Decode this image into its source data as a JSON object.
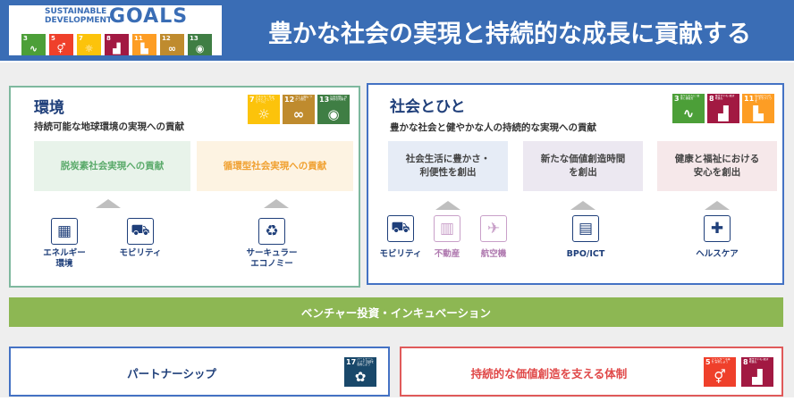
{
  "header": {
    "logo_line1": "SUSTAINABLE",
    "logo_line2": "DEVELOPMENT",
    "logo_goals": "GOALS",
    "title": "豊かな社会の実現と持続的な成長に貢献する",
    "sdg_icons": [
      {
        "num": "3",
        "color": "#4c9f38",
        "icon": "heartbeat-icon",
        "glyph": "∿"
      },
      {
        "num": "5",
        "color": "#ef402b",
        "icon": "gender-icon",
        "glyph": "⚥"
      },
      {
        "num": "7",
        "color": "#fcc30b",
        "icon": "sun-icon",
        "glyph": "☼"
      },
      {
        "num": "8",
        "color": "#a21942",
        "icon": "growth-chart-icon",
        "glyph": "▟"
      },
      {
        "num": "11",
        "color": "#fd9d24",
        "icon": "city-icon",
        "glyph": "▙"
      },
      {
        "num": "12",
        "color": "#bf8b2e",
        "icon": "infinity-icon",
        "glyph": "∞"
      },
      {
        "num": "13",
        "color": "#3f7e44",
        "icon": "eye-icon",
        "glyph": "◉"
      }
    ]
  },
  "environment": {
    "title": "環境",
    "subtitle": "持続可能な地球環境の実現への貢献",
    "sdg_icons": [
      {
        "num": "7",
        "caption": "エネルギーをみんなに そしてクリーンに",
        "color": "#fcc30b",
        "icon": "sun-icon",
        "glyph": "☼"
      },
      {
        "num": "12",
        "caption": "つくる責任 つかう責任",
        "color": "#bf8b2e",
        "icon": "infinity-icon",
        "glyph": "∞"
      },
      {
        "num": "13",
        "caption": "気候変動に 具体的な対策を",
        "color": "#3f7e44",
        "icon": "eye-icon",
        "glyph": "◉"
      }
    ],
    "themes": [
      {
        "label": "脱炭素社会実現への貢献",
        "bg": "#e8f3ea",
        "color": "#5aaa6a"
      },
      {
        "label": "循環型社会実現への貢献",
        "bg": "#fdf3e2",
        "color": "#f0a030"
      }
    ],
    "icons": [
      {
        "label_lines": [
          "エネルギー",
          "環境"
        ],
        "icon": "solar-panel-icon",
        "glyph": "▦"
      },
      {
        "label_lines": [
          "モビリティ"
        ],
        "icon": "car-icon",
        "glyph": "⛟"
      },
      {
        "label_lines": [
          "サーキュラー",
          "エコノミー"
        ],
        "icon": "recycle-icon",
        "glyph": "♻"
      }
    ]
  },
  "society": {
    "title": "社会とひと",
    "subtitle": "豊かな社会と健やかな人の持続的な実現への貢献",
    "sdg_icons": [
      {
        "num": "3",
        "caption": "すべての人に 健康と福祉を",
        "color": "#4c9f38",
        "icon": "heartbeat-icon",
        "glyph": "∿"
      },
      {
        "num": "8",
        "caption": "働きがいも 経済成長も",
        "color": "#a21942",
        "icon": "growth-chart-icon",
        "glyph": "▟"
      },
      {
        "num": "11",
        "caption": "住み続けられる まちづくりを",
        "color": "#fd9d24",
        "icon": "city-icon",
        "glyph": "▙"
      }
    ],
    "themes": [
      {
        "label": "社会生活に豊かさ・\n利便性を創出",
        "bg": "#e6ecf6",
        "color": "#444"
      },
      {
        "label": "新たな価値創造時間\nを創出",
        "bg": "#ece8f1",
        "color": "#444"
      },
      {
        "label": "健康と福祉における\n安心を創出",
        "bg": "#f6e8ea",
        "color": "#444"
      }
    ],
    "icons": [
      {
        "label": "モビリティ",
        "icon": "car-icon",
        "glyph": "⛟",
        "faded": false
      },
      {
        "label": "不動産",
        "icon": "building-icon",
        "glyph": "▥",
        "faded": true
      },
      {
        "label": "航空機",
        "icon": "airplane-icon",
        "glyph": "✈",
        "faded": true
      },
      {
        "label": "BPO/ICT",
        "icon": "calculator-icon",
        "glyph": "▤",
        "faded": false
      },
      {
        "label": "ヘルスケア",
        "icon": "medical-cross-icon",
        "glyph": "✚",
        "faded": false
      }
    ]
  },
  "venture": {
    "label": "ベンチャー投資・インキュベーション"
  },
  "partnership": {
    "label": "パートナーシップ",
    "sdg_icon": {
      "num": "17",
      "caption": "パートナーシップで 目標を達成しよう",
      "color": "#19486a",
      "icon": "flower-icon",
      "glyph": "✿"
    }
  },
  "value_system": {
    "label": "持続的な価値創造を支える体制",
    "sdg_icons": [
      {
        "num": "5",
        "caption": "ジェンダー平等を 実現しよう",
        "color": "#ef402b",
        "icon": "gender-icon",
        "glyph": "⚥"
      },
      {
        "num": "8",
        "caption": "働きがいも 経済成長も",
        "color": "#a21942",
        "icon": "growth-chart-icon",
        "glyph": "▟"
      }
    ]
  }
}
